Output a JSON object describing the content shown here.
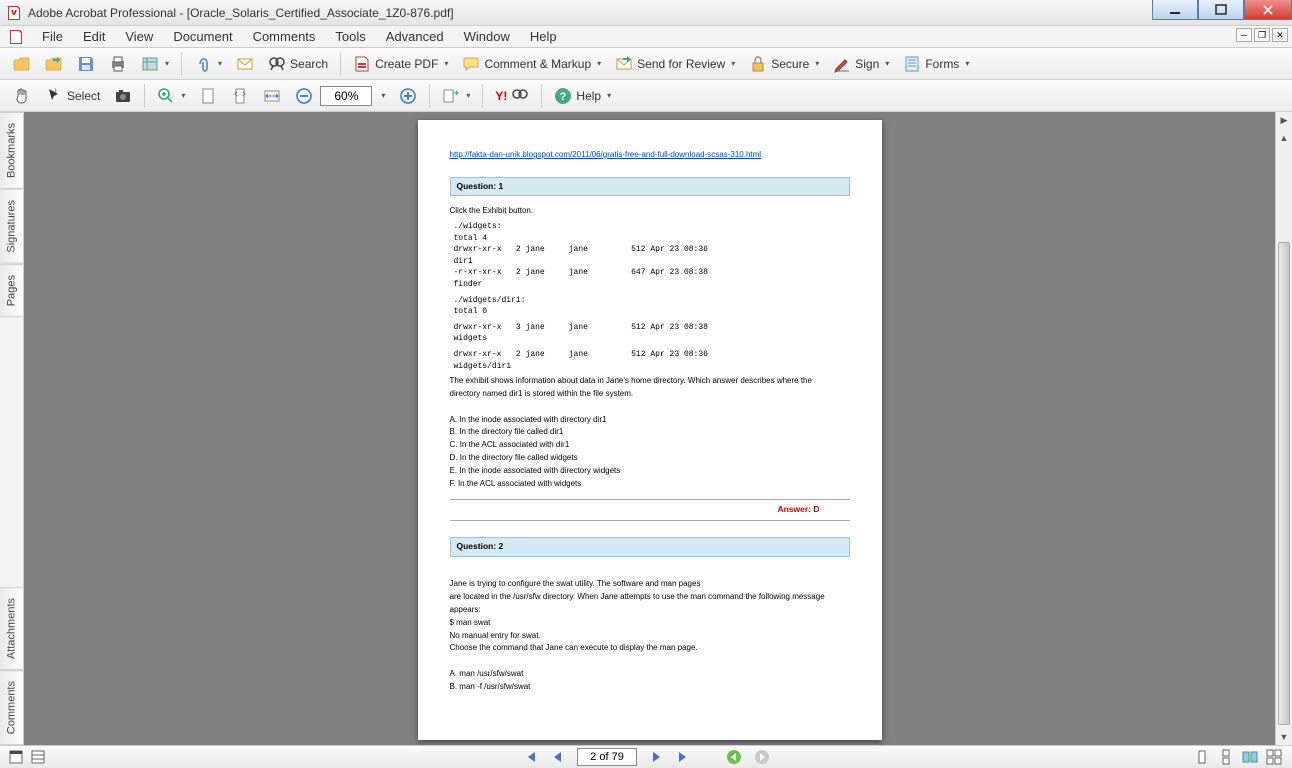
{
  "window": {
    "title": "Adobe Acrobat Professional - [Oracle_Solaris_Certified_Associate_1Z0-876.pdf]"
  },
  "menu": [
    "File",
    "Edit",
    "View",
    "Document",
    "Comments",
    "Tools",
    "Advanced",
    "Window",
    "Help"
  ],
  "toolbar1": {
    "search": "Search",
    "create_pdf": "Create PDF",
    "comment_markup": "Comment & Markup",
    "send_review": "Send for Review",
    "secure": "Secure",
    "sign": "Sign",
    "forms": "Forms"
  },
  "toolbar2": {
    "select": "Select",
    "zoom": "60%",
    "help": "Help"
  },
  "sidebar_tabs": [
    "Bookmarks",
    "Signatures",
    "Pages",
    "Attachments",
    "Comments"
  ],
  "statusbar": {
    "page": "2 of 79"
  },
  "document": {
    "url": "http://fakta-dan-unik.blogspot.com/2011/06/gratis-free-and-full-download-scsas-310.html",
    "q1": {
      "header": "Question: 1",
      "intro": "Click the Exhibit button.",
      "pre1": "./widgets:\ntotal 4\ndrwxr-xr-x   2 jane     jane         512 Apr 23 08:36\ndir1\n-r-xr-xr-x   2 jane     jane         647 Apr 23 08:38\nfinder",
      "pre2": "./widgets/dir1:\ntotal 0",
      "pre3": "drwxr-xr-x   3 jane     jane         512 Apr 23 08:38\nwidgets",
      "pre4": "drwxr-xr-x   2 jane     jane         512 Apr 23 08:36\nwidgets/dir1",
      "body1": "The exhibit shows information about data in Jane's home directory. Which answer describes where the",
      "body2": "directory named dir1 is stored within the file system.",
      "optA": "A. In the inode associated with directory dir1",
      "optB": "B. In the directory file called dir1",
      "optC": "C. In the ACL associated with dir1",
      "optD": "D. In the directory file called widgets",
      "optE": "E. In the inode associated with directory widgets",
      "optF": "F. In the ACL associated with widgets",
      "answer": "Answer: D"
    },
    "q2": {
      "header": "Question: 2",
      "l1": "Jane is trying to configure the swat utility. The software and man pages",
      "l2": "are located in the /usr/sfw directory. When Jane attempts to use the man command the following message",
      "l3": "appears:",
      "l4": "$ man swat",
      "l5": "No manual entry for swat.",
      "l6": "Choose the command that Jane can execute to display the man page.",
      "optA": "A. man /usr/sfw/swat",
      "optB": "B. man -f /usr/sfw/swat"
    }
  }
}
